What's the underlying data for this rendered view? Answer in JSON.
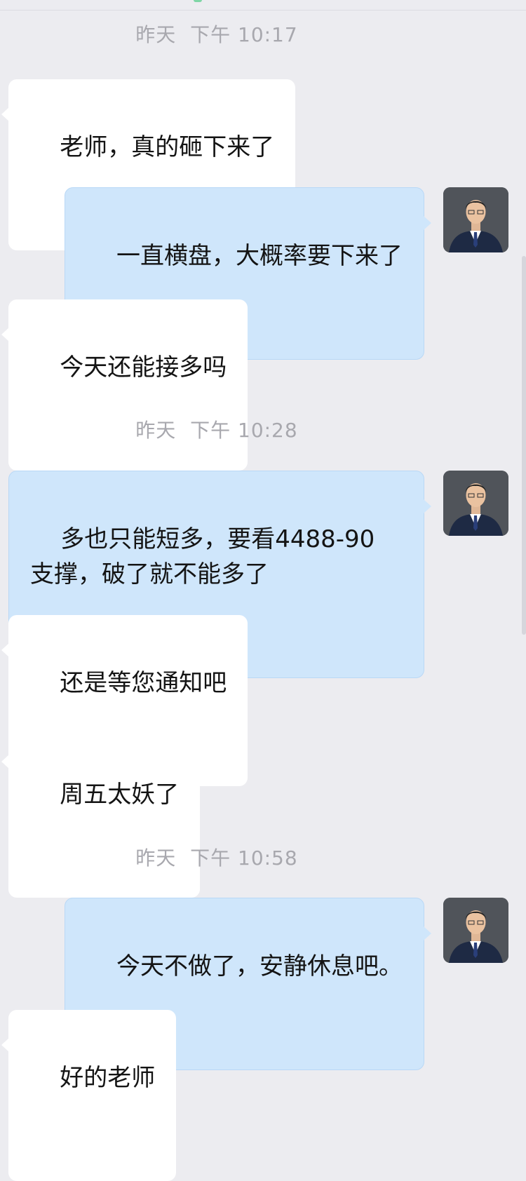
{
  "messages": [
    {
      "type": "time",
      "text": "昨天  下午 10:17"
    },
    {
      "type": "in",
      "text": "老师，真的砸下来了"
    },
    {
      "type": "out",
      "text": "一直横盘，大概率要下来了",
      "avatar": "teacher-avatar"
    },
    {
      "type": "in",
      "text": "今天还能接多吗"
    },
    {
      "type": "time",
      "text": "昨天  下午 10:28"
    },
    {
      "type": "out",
      "text": "多也只能短多，要看4488-90\n支撑，破了就不能多了",
      "avatar": "teacher-avatar"
    },
    {
      "type": "in",
      "text": "还是等您通知吧"
    },
    {
      "type": "in",
      "text": "周五太妖了"
    },
    {
      "type": "time",
      "text": "昨天  下午 10:58"
    },
    {
      "type": "out",
      "text": "今天不做了，安静休息吧。",
      "avatar": "teacher-avatar"
    },
    {
      "type": "in",
      "text": "好的老师"
    }
  ],
  "colors": {
    "background": "#ececf0",
    "incoming_bubble": "#ffffff",
    "outgoing_bubble": "#cfe6fb",
    "timestamp": "#a8a8ae"
  }
}
